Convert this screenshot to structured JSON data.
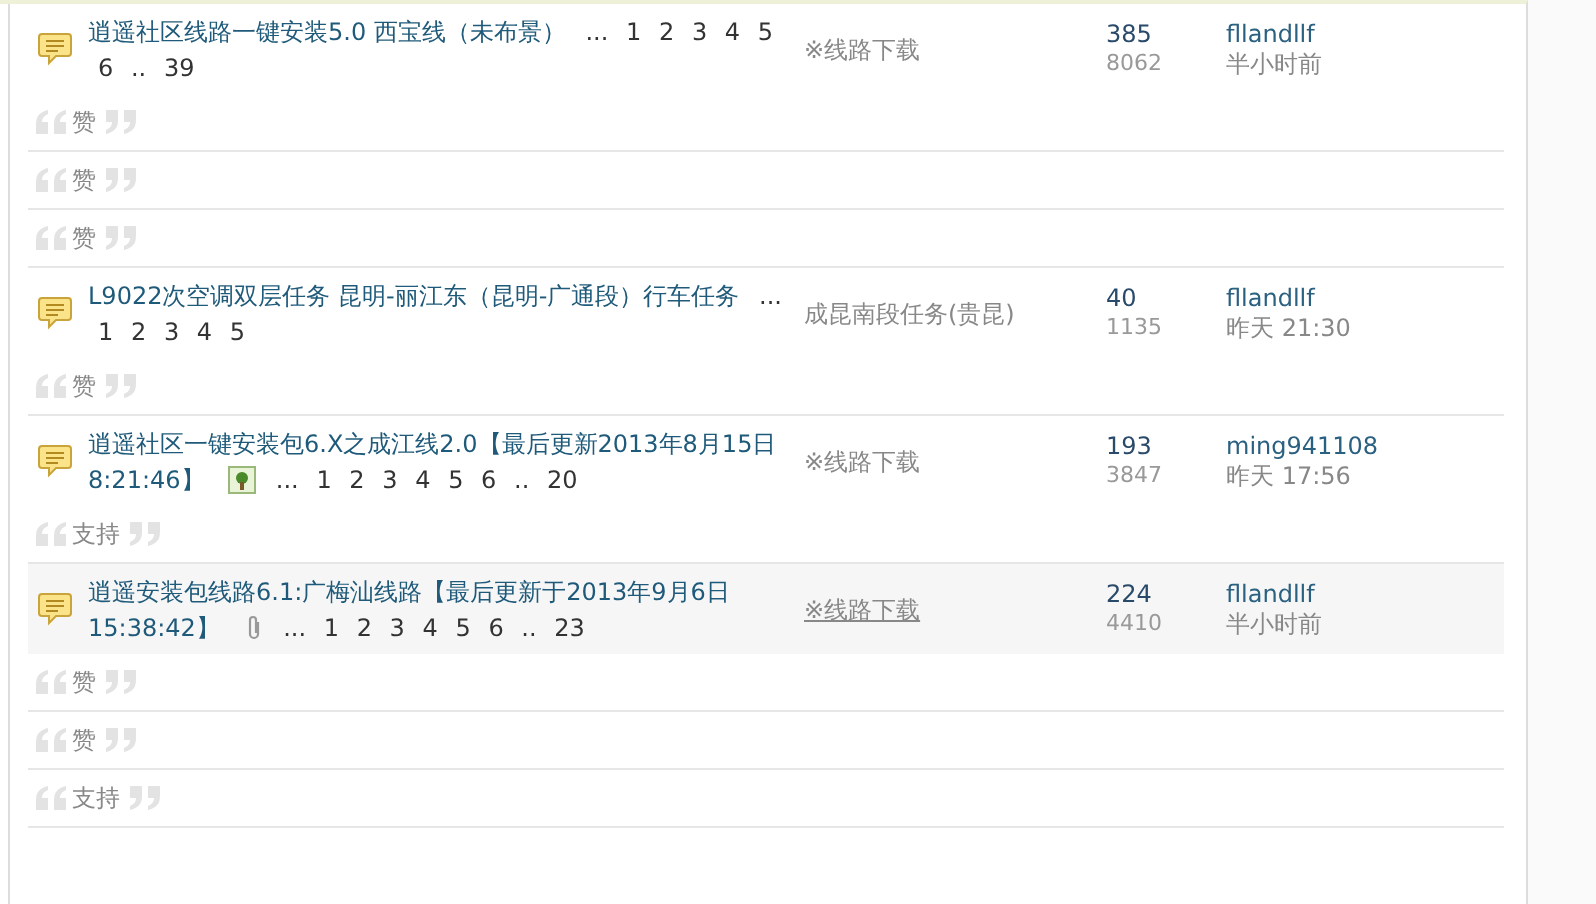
{
  "rows": [
    {
      "kind": "thread",
      "title": "逍遥社区线路一键安装5.0 西宝线（未布景）",
      "pages": [
        "...",
        "1",
        "2",
        "3",
        "4",
        "5",
        "6",
        "..",
        "39"
      ],
      "category": "※线路下载",
      "replies": "385",
      "views": "8062",
      "author": "fllandllf",
      "time": "半小时前",
      "hovered": false
    },
    {
      "kind": "reply",
      "text": "赞"
    },
    {
      "kind": "reply",
      "text": "赞"
    },
    {
      "kind": "reply",
      "text": "赞"
    },
    {
      "kind": "thread",
      "title": "L9022次空调双层任务  昆明-丽江东（昆明-广通段）行车任务",
      "pages": [
        "...",
        "1",
        "2",
        "3",
        "4",
        "5"
      ],
      "category": "成昆南段任务(贵昆)",
      "replies": "40",
      "views": "1135",
      "author": "fllandllf",
      "time": "昨天 21:30",
      "hovered": false
    },
    {
      "kind": "reply",
      "text": "赞"
    },
    {
      "kind": "thread",
      "title": "逍遥社区一键安装包6.X之成江线2.0【最后更新2013年8月15日 8:21:46】",
      "has_image": true,
      "pages": [
        "...",
        "1",
        "2",
        "3",
        "4",
        "5",
        "6",
        "..",
        "20"
      ],
      "category": "※线路下载",
      "replies": "193",
      "views": "3847",
      "author": "ming941108",
      "time": "昨天 17:56",
      "hovered": false
    },
    {
      "kind": "reply",
      "text": "支持"
    },
    {
      "kind": "thread",
      "title": "逍遥安装包线路6.1:广梅汕线路【最后更新于2013年9月6日 15:38:42】",
      "has_attachment": true,
      "pages": [
        "...",
        "1",
        "2",
        "3",
        "4",
        "5",
        "6",
        "..",
        "23"
      ],
      "category": "※线路下载",
      "replies": "224",
      "views": "4410",
      "author": "fllandllf",
      "time": "半小时前",
      "hovered": true
    },
    {
      "kind": "reply",
      "text": "赞"
    },
    {
      "kind": "reply",
      "text": "赞"
    },
    {
      "kind": "reply",
      "text": "支持"
    }
  ]
}
